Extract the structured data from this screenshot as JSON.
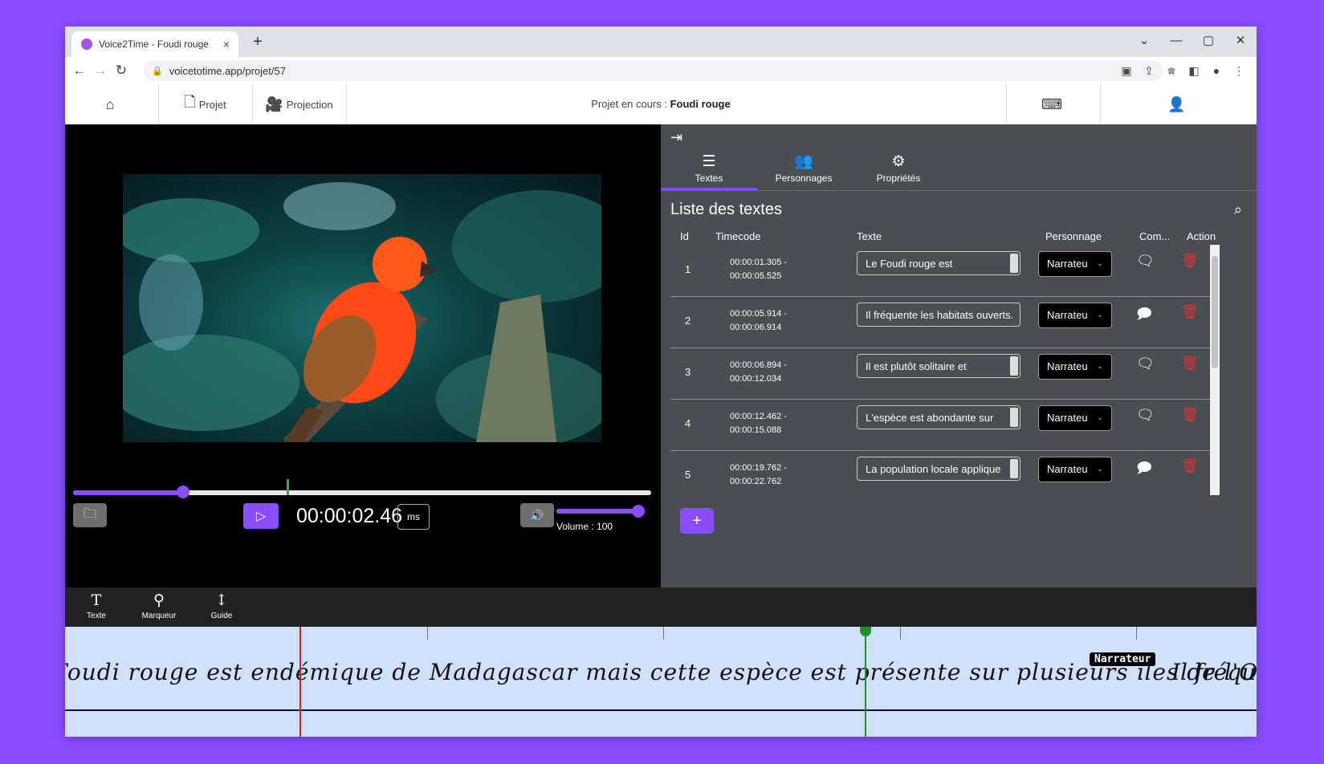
{
  "colors": {
    "background": "#8a4cff",
    "accent": "#8a4cff"
  },
  "browser": {
    "tab_title": "Voice2Time - Foudi rouge",
    "tab_close": "×",
    "new_tab": "+",
    "url": "voicetotime.app/projet/57",
    "window_controls": [
      "⌄",
      "—",
      "▢",
      "✕"
    ]
  },
  "header": {
    "home_icon": "home-icon",
    "projet_label": "Projet",
    "projection_label": "Projection",
    "project_prefix": "Projet en cours : ",
    "project_name": "Foudi rouge",
    "keyboard_icon": "keyboard-icon",
    "user_icon": "user-icon"
  },
  "player": {
    "time": "00:00:02.46",
    "ms_label": "ms",
    "volume_label": "Volume : 100",
    "progress_fraction": 0.19,
    "marker_fraction": 0.37,
    "volume_fraction": 1.0
  },
  "panel": {
    "tabs": [
      {
        "label": "Textes",
        "icon": "list-icon",
        "active": true
      },
      {
        "label": "Personnages",
        "icon": "people-icon",
        "active": false
      },
      {
        "label": "Propriétés",
        "icon": "gear-icon",
        "active": false
      }
    ],
    "list_title": "Liste des textes",
    "columns": [
      "Id",
      "Timecode",
      "Texte",
      "Personnage",
      "Com...",
      "Action"
    ],
    "rows": [
      {
        "id": "1",
        "tc_start": "00:00:01.305 -",
        "tc_end": "00:00:05.525",
        "text": "Le Foudi rouge est",
        "spinner": true,
        "character": "Narrateu",
        "comment_icon": "comment-empty-icon"
      },
      {
        "id": "2",
        "tc_start": "00:00:05.914 -",
        "tc_end": "00:00:06.914",
        "text": "Il fréquente les habitats ouverts.",
        "spinner": false,
        "character": "Narrateu",
        "comment_icon": "comment-filled-icon"
      },
      {
        "id": "3",
        "tc_start": "00:00:06.894 -",
        "tc_end": "00:00:12.034",
        "text": "Il est plutôt solitaire et",
        "spinner": true,
        "character": "Narrateu",
        "comment_icon": "comment-empty-icon"
      },
      {
        "id": "4",
        "tc_start": "00:00:12.462 -",
        "tc_end": "00:00:15.088",
        "text": "L'espèce est abondante sur",
        "spinner": true,
        "character": "Narrateu",
        "comment_icon": "comment-empty-icon"
      },
      {
        "id": "5",
        "tc_start": "00:00:19.762 -",
        "tc_end": "00:00:22.762",
        "text": "La population locale applique",
        "spinner": true,
        "character": "Narrateu",
        "comment_icon": "comment-filled-icon"
      }
    ],
    "add_label": "+"
  },
  "timeline_toolbar": [
    {
      "label": "Texte",
      "icon": "text-tool-icon"
    },
    {
      "label": "Marqueur",
      "icon": "pin-icon"
    },
    {
      "label": "Guide",
      "icon": "guide-icon"
    }
  ],
  "timeline": {
    "text": "Foudi rouge est endémique de Madagascar mais cette espèce est présente sur plusieurs îles de l'Océan Indien.",
    "badge": "Narrateur",
    "next_text": "Il fréquente"
  }
}
